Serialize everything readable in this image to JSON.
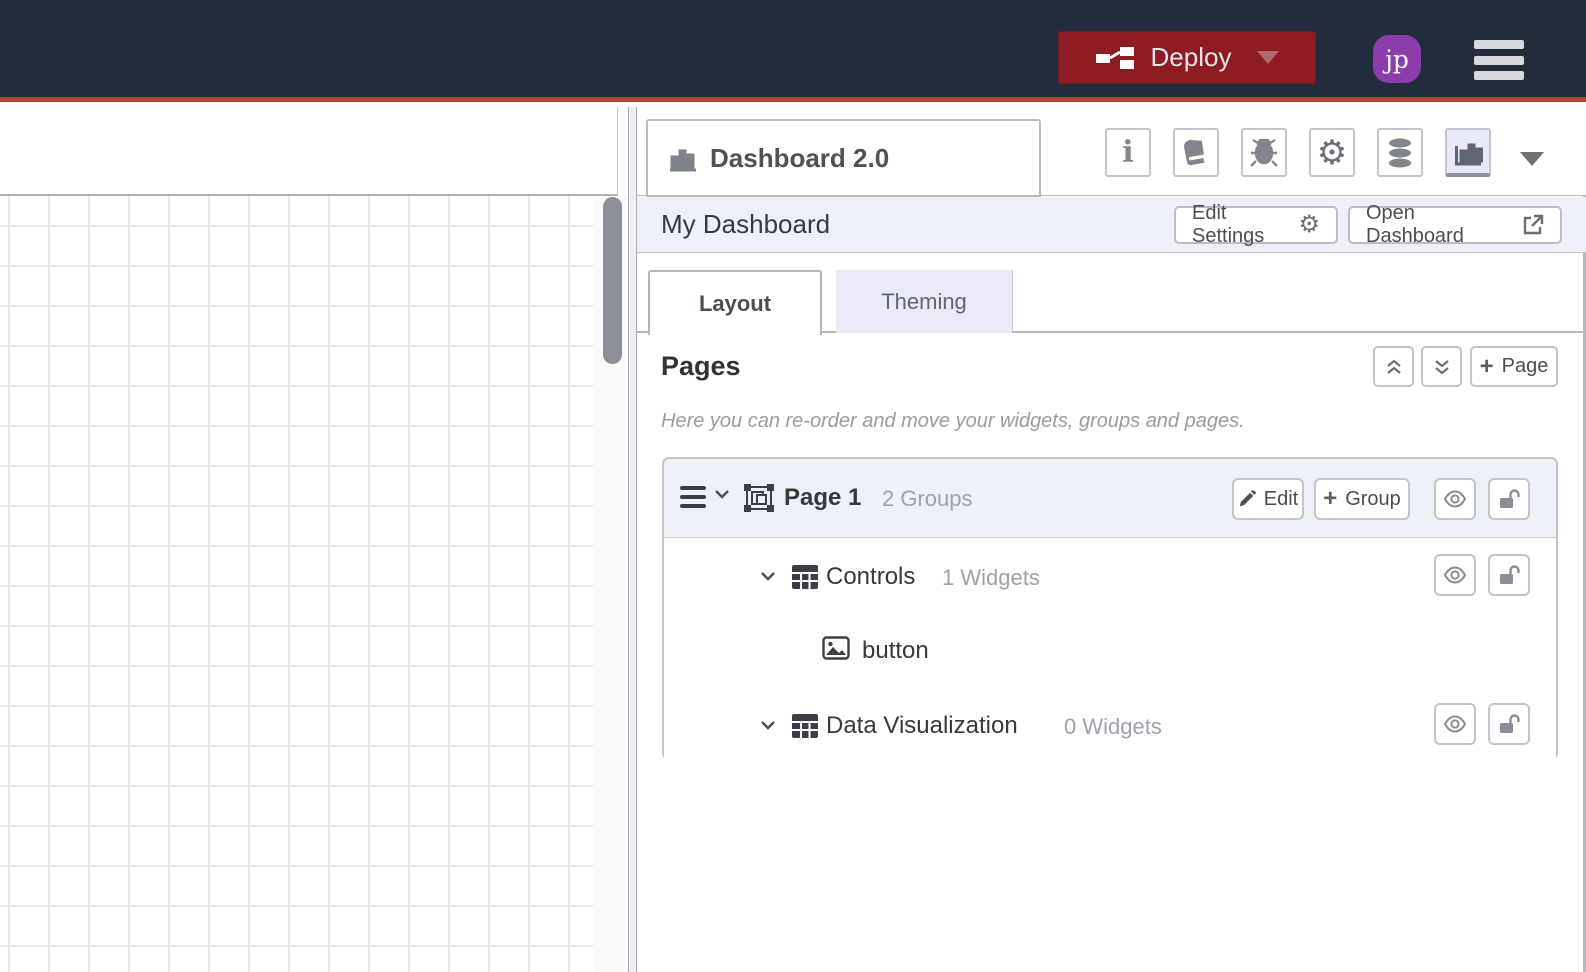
{
  "colors": {
    "navbar_bg": "#222c3a",
    "accent_red": "#c93a38",
    "deploy_red": "#8e1a22",
    "avatar_purple": "#8a3dab",
    "panel_lavender": "#eef0f8"
  },
  "navbar": {
    "deploy_label": "Deploy",
    "avatar_initials": "jp",
    "icons": [
      "deploy-icon",
      "caret-down-icon",
      "hamburger-menu-icon"
    ]
  },
  "workspace": {
    "icons": [
      "add-flow-icon",
      "flow-list-caret-icon",
      "vertical-scrollbar"
    ]
  },
  "sidebar": {
    "tab_title": "Dashboard 2.0",
    "tool_icons": [
      "info-icon",
      "book-icon",
      "bug-icon",
      "gear-icon",
      "database-icon",
      "chart-icon",
      "caret-down-icon"
    ],
    "active_tool": "chart-icon",
    "panel": {
      "title": "My Dashboard",
      "edit_settings_label": "Edit Settings",
      "open_dashboard_label": "Open Dashboard"
    },
    "tabs": [
      {
        "label": "Layout",
        "active": true
      },
      {
        "label": "Theming",
        "active": false
      }
    ],
    "pages_section": {
      "heading": "Pages",
      "add_page_label": "Page",
      "description": "Here you can re-order and move your widgets, groups and pages."
    },
    "page_card": {
      "page": {
        "name": "Page 1",
        "count": "2 Groups",
        "edit_label": "Edit",
        "add_group_label": "Group"
      },
      "groups": [
        {
          "name": "Controls",
          "count": "1 Widgets"
        },
        {
          "name": "Data Visualization",
          "count": "0 Widgets"
        }
      ],
      "widgets": [
        {
          "group": "Controls",
          "name": "button"
        }
      ]
    }
  }
}
